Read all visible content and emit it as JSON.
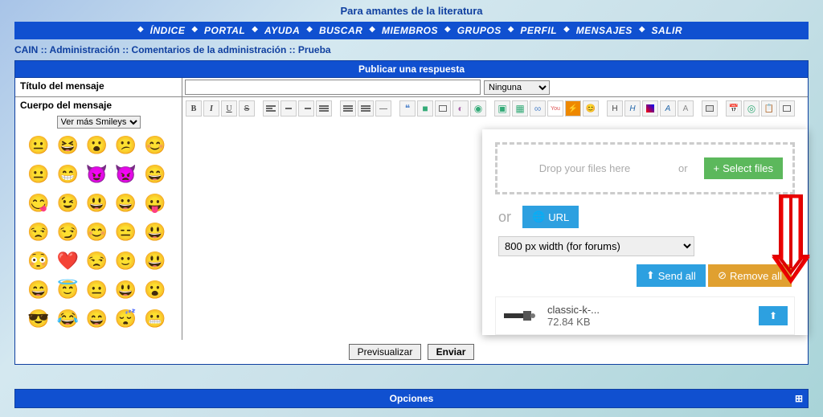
{
  "site_title": "Para amantes de la literatura",
  "nav": [
    "ÍNDICE",
    "PORTAL",
    "AYUDA",
    "BUSCAR",
    "MIEMBROS",
    "GRUPOS",
    "PERFIL",
    "MENSAJES",
    "SALIR"
  ],
  "breadcrumb": "CAIN  :: Administración :: Comentarios de la administración :: Prueba",
  "panel_title": "Publicar una respuesta",
  "form": {
    "title_label": "Título del mensaje",
    "title_value": "",
    "select_value": "Ninguna",
    "body_label": "Cuerpo del mensaje",
    "smiley_select": "Ver más Smileys"
  },
  "buttons": {
    "preview": "Previsualizar",
    "send": "Enviar"
  },
  "options_label": "Opciones",
  "uploader": {
    "drop_text": "Drop your files here",
    "or": "or",
    "or2": "or",
    "select_files": "Select files",
    "url": "URL",
    "width_option": "800 px width (for forums)",
    "send_all": "Send all",
    "remove_all": "Remove all",
    "file_name": "classic-k-...",
    "file_size": "72.84 KB"
  }
}
